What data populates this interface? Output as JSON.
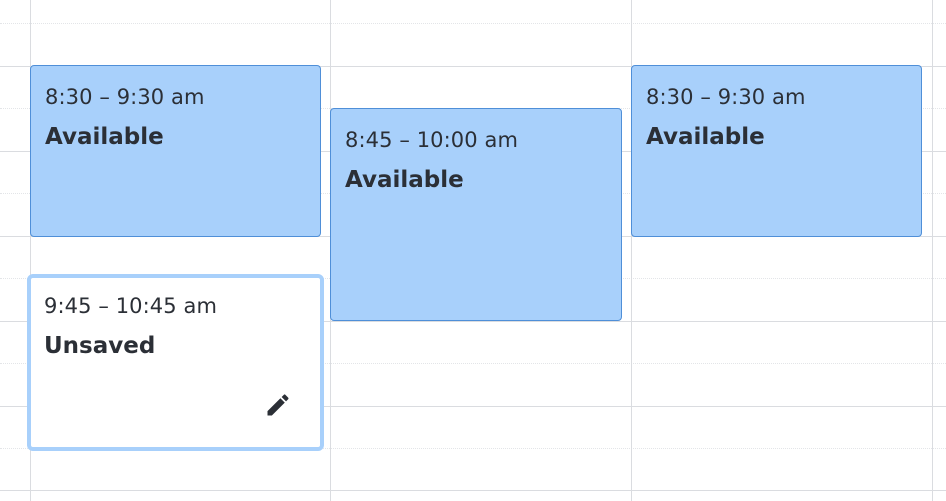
{
  "events": [
    {
      "time": "8:30 – 9:30 am",
      "title": "Available",
      "status": "available"
    },
    {
      "time": "8:45 – 10:00 am",
      "title": "Available",
      "status": "available"
    },
    {
      "time": "8:30 – 9:30 am",
      "title": "Available",
      "status": "available"
    },
    {
      "time": "9:45 – 10:45 am",
      "title": "Unsaved",
      "status": "unsaved",
      "icon": "pencil-icon"
    }
  ],
  "colors": {
    "available_fill": "#a8d0fb",
    "available_border": "#4f8fd8",
    "unsaved_border": "#a8d0fb",
    "grid_line": "#dadce0",
    "text": "#2b2f36"
  }
}
